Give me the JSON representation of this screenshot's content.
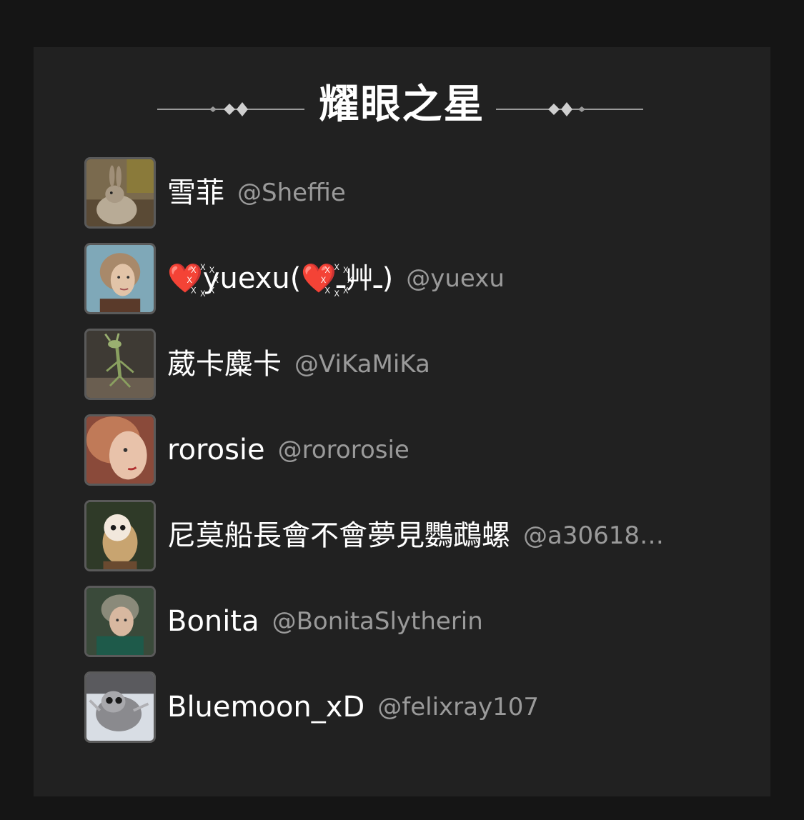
{
  "title": "耀眼之星",
  "users": [
    {
      "display_name": "雪菲",
      "handle": "@Sheffie",
      "avatar": "rabbit-avatar"
    },
    {
      "display_name": "❤️꙰yuexu(❤️꙰ـ艸ـ)",
      "handle": "@yuexu",
      "avatar": "woman-portrait-avatar"
    },
    {
      "display_name": "葳卡麋卡",
      "handle": "@ViKaMiKa",
      "avatar": "bowtruckle-avatar"
    },
    {
      "display_name": "rorosie",
      "handle": "@rororosie",
      "avatar": "red-hair-woman-avatar"
    },
    {
      "display_name": "尼莫船長會不會夢見鸚鵡螺",
      "handle": "@a30618…",
      "avatar": "owl-avatar"
    },
    {
      "display_name": "Bonita",
      "handle": "@BonitaSlytherin",
      "avatar": "professor-avatar"
    },
    {
      "display_name": "Bluemoon_xD",
      "handle": "@felixray107",
      "avatar": "grey-creature-avatar"
    }
  ]
}
